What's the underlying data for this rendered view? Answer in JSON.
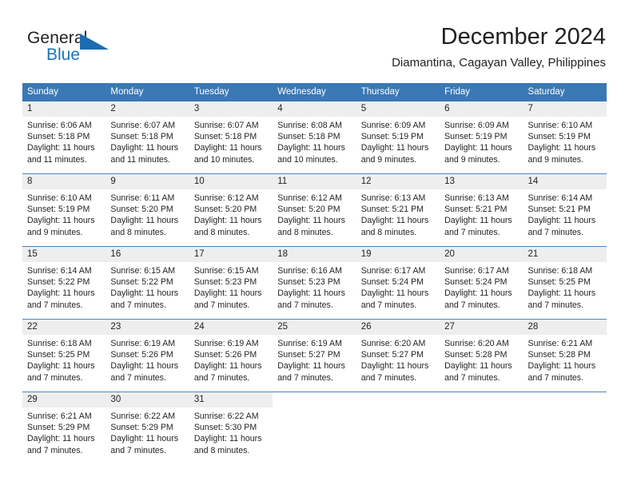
{
  "brand": {
    "name_part1": "General",
    "name_part2": "Blue",
    "accent_color": "#1b75bb",
    "triangle_color": "#1b6cb0"
  },
  "header": {
    "title": "December 2024",
    "subtitle": "Diamantina, Cagayan Valley, Philippines",
    "header_bg_color": "#3a78b5",
    "day_band_color": "#eeeeee"
  },
  "weekdays": [
    "Sunday",
    "Monday",
    "Tuesday",
    "Wednesday",
    "Thursday",
    "Friday",
    "Saturday"
  ],
  "weeks": [
    [
      {
        "day": "1",
        "sunrise": "Sunrise: 6:06 AM",
        "sunset": "Sunset: 5:18 PM",
        "daylight1": "Daylight: 11 hours",
        "daylight2": "and 11 minutes."
      },
      {
        "day": "2",
        "sunrise": "Sunrise: 6:07 AM",
        "sunset": "Sunset: 5:18 PM",
        "daylight1": "Daylight: 11 hours",
        "daylight2": "and 11 minutes."
      },
      {
        "day": "3",
        "sunrise": "Sunrise: 6:07 AM",
        "sunset": "Sunset: 5:18 PM",
        "daylight1": "Daylight: 11 hours",
        "daylight2": "and 10 minutes."
      },
      {
        "day": "4",
        "sunrise": "Sunrise: 6:08 AM",
        "sunset": "Sunset: 5:18 PM",
        "daylight1": "Daylight: 11 hours",
        "daylight2": "and 10 minutes."
      },
      {
        "day": "5",
        "sunrise": "Sunrise: 6:09 AM",
        "sunset": "Sunset: 5:19 PM",
        "daylight1": "Daylight: 11 hours",
        "daylight2": "and 9 minutes."
      },
      {
        "day": "6",
        "sunrise": "Sunrise: 6:09 AM",
        "sunset": "Sunset: 5:19 PM",
        "daylight1": "Daylight: 11 hours",
        "daylight2": "and 9 minutes."
      },
      {
        "day": "7",
        "sunrise": "Sunrise: 6:10 AM",
        "sunset": "Sunset: 5:19 PM",
        "daylight1": "Daylight: 11 hours",
        "daylight2": "and 9 minutes."
      }
    ],
    [
      {
        "day": "8",
        "sunrise": "Sunrise: 6:10 AM",
        "sunset": "Sunset: 5:19 PM",
        "daylight1": "Daylight: 11 hours",
        "daylight2": "and 9 minutes."
      },
      {
        "day": "9",
        "sunrise": "Sunrise: 6:11 AM",
        "sunset": "Sunset: 5:20 PM",
        "daylight1": "Daylight: 11 hours",
        "daylight2": "and 8 minutes."
      },
      {
        "day": "10",
        "sunrise": "Sunrise: 6:12 AM",
        "sunset": "Sunset: 5:20 PM",
        "daylight1": "Daylight: 11 hours",
        "daylight2": "and 8 minutes."
      },
      {
        "day": "11",
        "sunrise": "Sunrise: 6:12 AM",
        "sunset": "Sunset: 5:20 PM",
        "daylight1": "Daylight: 11 hours",
        "daylight2": "and 8 minutes."
      },
      {
        "day": "12",
        "sunrise": "Sunrise: 6:13 AM",
        "sunset": "Sunset: 5:21 PM",
        "daylight1": "Daylight: 11 hours",
        "daylight2": "and 8 minutes."
      },
      {
        "day": "13",
        "sunrise": "Sunrise: 6:13 AM",
        "sunset": "Sunset: 5:21 PM",
        "daylight1": "Daylight: 11 hours",
        "daylight2": "and 7 minutes."
      },
      {
        "day": "14",
        "sunrise": "Sunrise: 6:14 AM",
        "sunset": "Sunset: 5:21 PM",
        "daylight1": "Daylight: 11 hours",
        "daylight2": "and 7 minutes."
      }
    ],
    [
      {
        "day": "15",
        "sunrise": "Sunrise: 6:14 AM",
        "sunset": "Sunset: 5:22 PM",
        "daylight1": "Daylight: 11 hours",
        "daylight2": "and 7 minutes."
      },
      {
        "day": "16",
        "sunrise": "Sunrise: 6:15 AM",
        "sunset": "Sunset: 5:22 PM",
        "daylight1": "Daylight: 11 hours",
        "daylight2": "and 7 minutes."
      },
      {
        "day": "17",
        "sunrise": "Sunrise: 6:15 AM",
        "sunset": "Sunset: 5:23 PM",
        "daylight1": "Daylight: 11 hours",
        "daylight2": "and 7 minutes."
      },
      {
        "day": "18",
        "sunrise": "Sunrise: 6:16 AM",
        "sunset": "Sunset: 5:23 PM",
        "daylight1": "Daylight: 11 hours",
        "daylight2": "and 7 minutes."
      },
      {
        "day": "19",
        "sunrise": "Sunrise: 6:17 AM",
        "sunset": "Sunset: 5:24 PM",
        "daylight1": "Daylight: 11 hours",
        "daylight2": "and 7 minutes."
      },
      {
        "day": "20",
        "sunrise": "Sunrise: 6:17 AM",
        "sunset": "Sunset: 5:24 PM",
        "daylight1": "Daylight: 11 hours",
        "daylight2": "and 7 minutes."
      },
      {
        "day": "21",
        "sunrise": "Sunrise: 6:18 AM",
        "sunset": "Sunset: 5:25 PM",
        "daylight1": "Daylight: 11 hours",
        "daylight2": "and 7 minutes."
      }
    ],
    [
      {
        "day": "22",
        "sunrise": "Sunrise: 6:18 AM",
        "sunset": "Sunset: 5:25 PM",
        "daylight1": "Daylight: 11 hours",
        "daylight2": "and 7 minutes."
      },
      {
        "day": "23",
        "sunrise": "Sunrise: 6:19 AM",
        "sunset": "Sunset: 5:26 PM",
        "daylight1": "Daylight: 11 hours",
        "daylight2": "and 7 minutes."
      },
      {
        "day": "24",
        "sunrise": "Sunrise: 6:19 AM",
        "sunset": "Sunset: 5:26 PM",
        "daylight1": "Daylight: 11 hours",
        "daylight2": "and 7 minutes."
      },
      {
        "day": "25",
        "sunrise": "Sunrise: 6:19 AM",
        "sunset": "Sunset: 5:27 PM",
        "daylight1": "Daylight: 11 hours",
        "daylight2": "and 7 minutes."
      },
      {
        "day": "26",
        "sunrise": "Sunrise: 6:20 AM",
        "sunset": "Sunset: 5:27 PM",
        "daylight1": "Daylight: 11 hours",
        "daylight2": "and 7 minutes."
      },
      {
        "day": "27",
        "sunrise": "Sunrise: 6:20 AM",
        "sunset": "Sunset: 5:28 PM",
        "daylight1": "Daylight: 11 hours",
        "daylight2": "and 7 minutes."
      },
      {
        "day": "28",
        "sunrise": "Sunrise: 6:21 AM",
        "sunset": "Sunset: 5:28 PM",
        "daylight1": "Daylight: 11 hours",
        "daylight2": "and 7 minutes."
      }
    ],
    [
      {
        "day": "29",
        "sunrise": "Sunrise: 6:21 AM",
        "sunset": "Sunset: 5:29 PM",
        "daylight1": "Daylight: 11 hours",
        "daylight2": "and 7 minutes."
      },
      {
        "day": "30",
        "sunrise": "Sunrise: 6:22 AM",
        "sunset": "Sunset: 5:29 PM",
        "daylight1": "Daylight: 11 hours",
        "daylight2": "and 7 minutes."
      },
      {
        "day": "31",
        "sunrise": "Sunrise: 6:22 AM",
        "sunset": "Sunset: 5:30 PM",
        "daylight1": "Daylight: 11 hours",
        "daylight2": "and 8 minutes."
      },
      {
        "day": "",
        "sunrise": "",
        "sunset": "",
        "daylight1": "",
        "daylight2": ""
      },
      {
        "day": "",
        "sunrise": "",
        "sunset": "",
        "daylight1": "",
        "daylight2": ""
      },
      {
        "day": "",
        "sunrise": "",
        "sunset": "",
        "daylight1": "",
        "daylight2": ""
      },
      {
        "day": "",
        "sunrise": "",
        "sunset": "",
        "daylight1": "",
        "daylight2": ""
      }
    ]
  ]
}
